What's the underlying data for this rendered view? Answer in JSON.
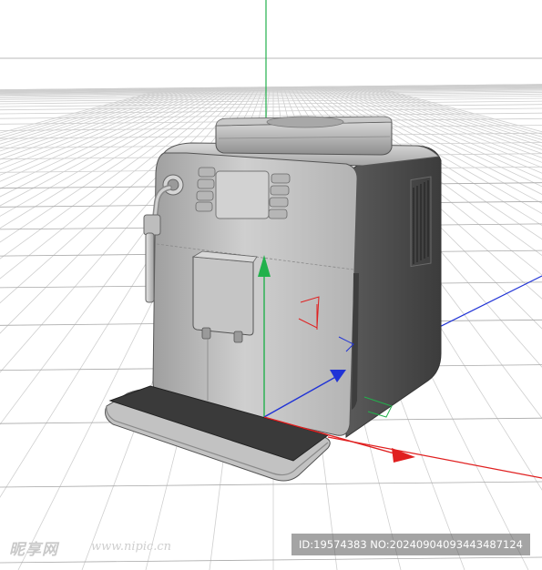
{
  "scene": {
    "description_type": "3d-viewport-render",
    "object": "coffee-machine",
    "colors": {
      "background": "#ffffff",
      "grid_line": "#a8a8a8",
      "grid_line_far": "#cfcfcf",
      "axis_green": "#22b14c",
      "axis_red": "#e02020",
      "axis_blue": "#2033d6",
      "body_light": "#c8c8c8",
      "body_dark": "#4a4a4a",
      "tray_dark": "#3a3a3a"
    }
  },
  "watermark": {
    "logo_text": "昵享网",
    "url_text": "www.nipic.cn",
    "id_text": "ID:19574383 NO:20240904093443487124"
  }
}
